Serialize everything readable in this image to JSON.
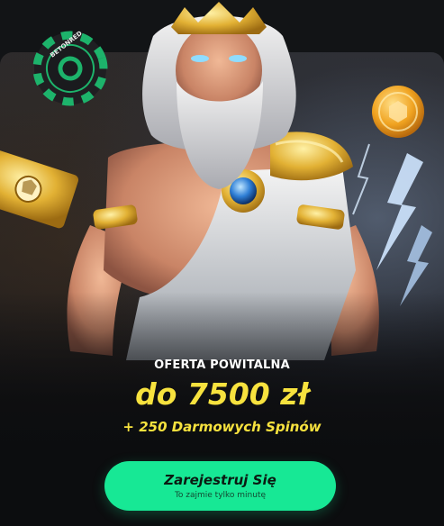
{
  "promo": {
    "headline": "OFERTA POWITALNA",
    "amount": "do 7500 zł",
    "spins": "+ 250 Darmowych Spinów",
    "cta": {
      "label": "Zarejestruj Się",
      "sublabel": "To zajmie tylko minutę"
    }
  },
  "chip_text": "BETONRED",
  "colors": {
    "background": "#121416",
    "accent_yellow": "#f7e23e",
    "cta_green": "#17e895",
    "chip_green": "#1db36b",
    "gold": "#d8a727"
  },
  "icons": [
    "betonred-chip-icon",
    "gold-coin-icon",
    "golden-ticket-icon",
    "lightning-icon",
    "zeus-illustration"
  ]
}
